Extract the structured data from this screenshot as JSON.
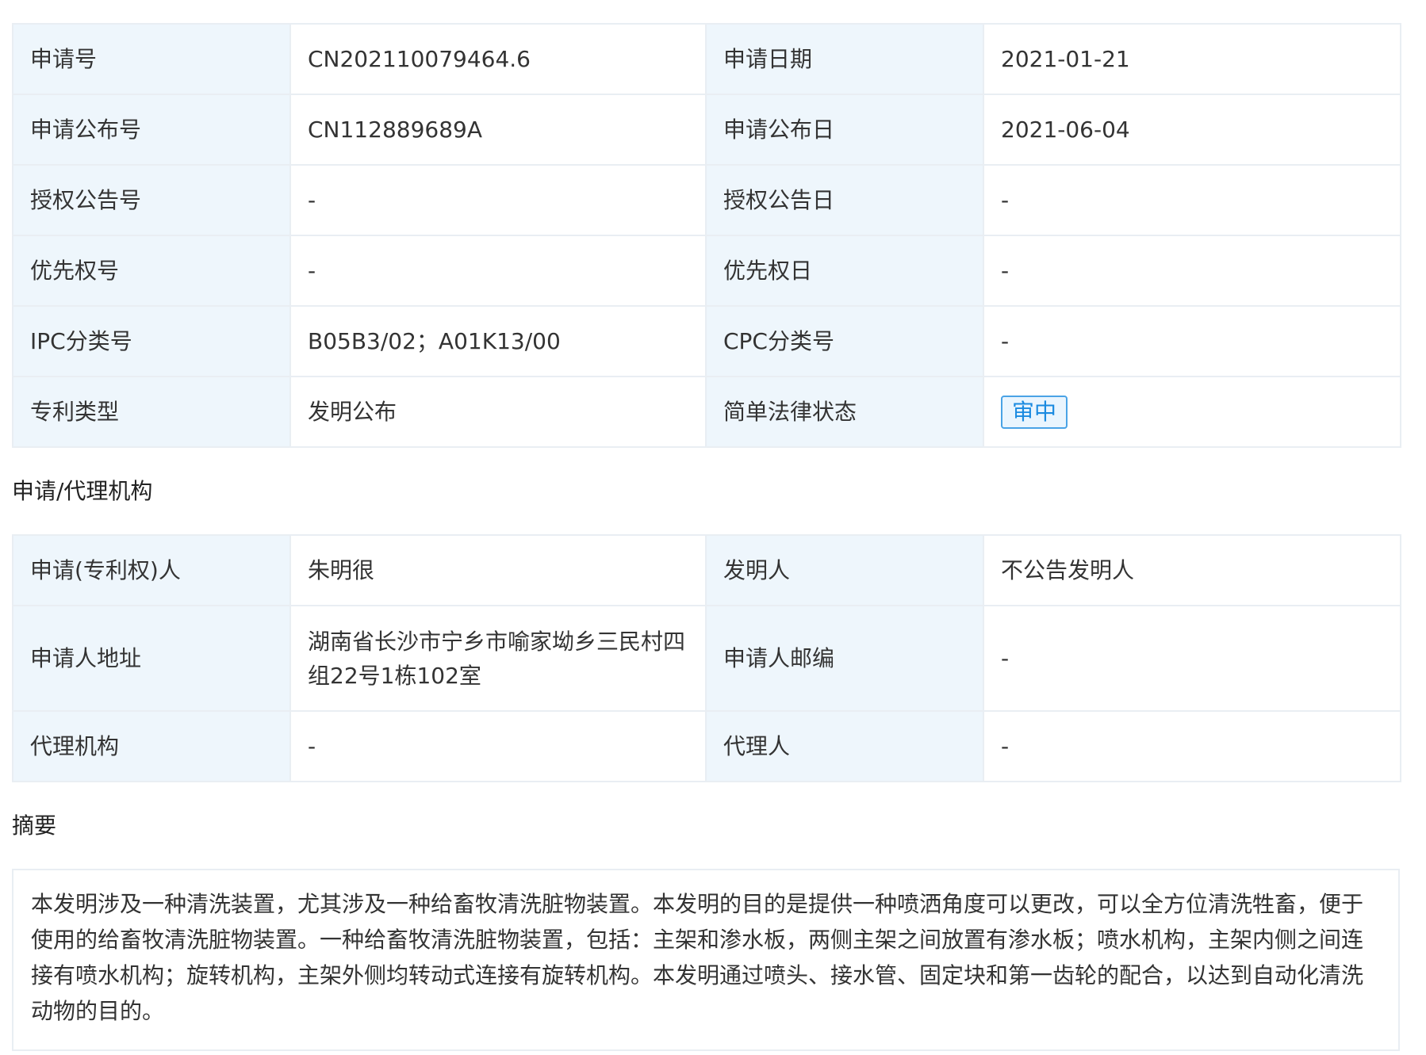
{
  "basic": {
    "rows": [
      {
        "l1": "申请号",
        "v1": "CN202110079464.6",
        "l2": "申请日期",
        "v2": "2021-01-21"
      },
      {
        "l1": "申请公布号",
        "v1": "CN112889689A",
        "l2": "申请公布日",
        "v2": "2021-06-04"
      },
      {
        "l1": "授权公告号",
        "v1": "-",
        "l2": "授权公告日",
        "v2": "-"
      },
      {
        "l1": "优先权号",
        "v1": "-",
        "l2": "优先权日",
        "v2": "-"
      },
      {
        "l1": "IPC分类号",
        "v1": "B05B3/02；A01K13/00",
        "l2": "CPC分类号",
        "v2": "-"
      },
      {
        "l1": "专利类型",
        "v1": "发明公布",
        "l2": "简单法律状态",
        "v2": "审中"
      }
    ]
  },
  "agency": {
    "title": "申请/代理机构",
    "rows": [
      {
        "l1": "申请(专利权)人",
        "v1": "朱明很",
        "l2": "发明人",
        "v2": "不公告发明人"
      },
      {
        "l1": "申请人地址",
        "v1": "湖南省长沙市宁乡市喻家坳乡三民村四组22号1栋102室",
        "l2": "申请人邮编",
        "v2": "-"
      },
      {
        "l1": "代理机构",
        "v1": "-",
        "l2": "代理人",
        "v2": "-"
      }
    ]
  },
  "abstract": {
    "title": "摘要",
    "text": "本发明涉及一种清洗装置，尤其涉及一种给畜牧清洗脏物装置。本发明的目的是提供一种喷洒角度可以更改，可以全方位清洗牲畜，便于使用的给畜牧清洗脏物装置。一种给畜牧清洗脏物装置，包括：主架和渗水板，两侧主架之间放置有渗水板；喷水机构，主架内侧之间连接有喷水机构；旋转机构，主架外侧均转动式连接有旋转机构。本发明通过喷头、接水管、固定块和第一齿轮的配合，以达到自动化清洗动物的目的。"
  }
}
